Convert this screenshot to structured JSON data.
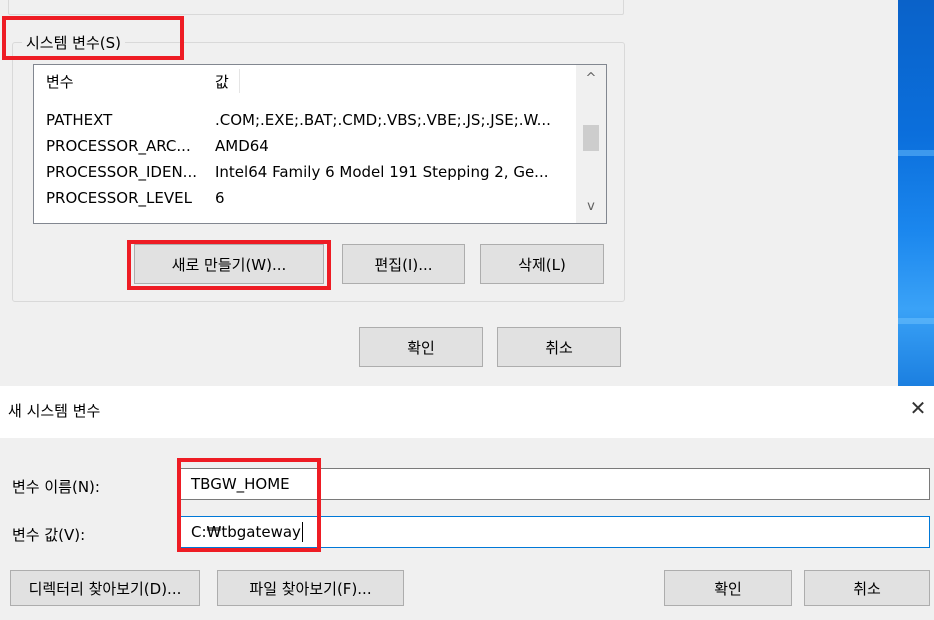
{
  "env_dialog": {
    "system_group_label": "시스템 변수(S)",
    "columns": [
      "변수",
      "값"
    ],
    "rows": [
      {
        "name": "PATHEXT",
        "value": ".COM;.EXE;.BAT;.CMD;.VBS;.VBE;.JS;.JSE;.W..."
      },
      {
        "name": "PROCESSOR_ARC...",
        "value": "AMD64"
      },
      {
        "name": "PROCESSOR_IDEN...",
        "value": "Intel64 Family 6 Model 191 Stepping 2, Ge..."
      },
      {
        "name": "PROCESSOR_LEVEL",
        "value": "6"
      }
    ],
    "buttons": {
      "new": "새로 만들기(W)...",
      "edit": "편집(I)...",
      "delete": "삭제(L)",
      "ok": "확인",
      "cancel": "취소"
    },
    "scroll_up_glyph": "^",
    "scroll_down_glyph": "v"
  },
  "new_var_dialog": {
    "title": "새 시스템 변수",
    "close_glyph": "✕",
    "name_label": "변수 이름(N):",
    "name_value": "TBGW_HOME",
    "value_label": "변수 값(V):",
    "value_value": "C:₩tbgateway",
    "buttons": {
      "browse_dir": "디렉터리 찾아보기(D)...",
      "browse_file": "파일 찾아보기(F)...",
      "ok": "확인",
      "cancel": "취소"
    }
  },
  "colors": {
    "highlight": "#ee1c24",
    "dialog_bg": "#f0f0f0",
    "focus_border": "#0078d7"
  }
}
